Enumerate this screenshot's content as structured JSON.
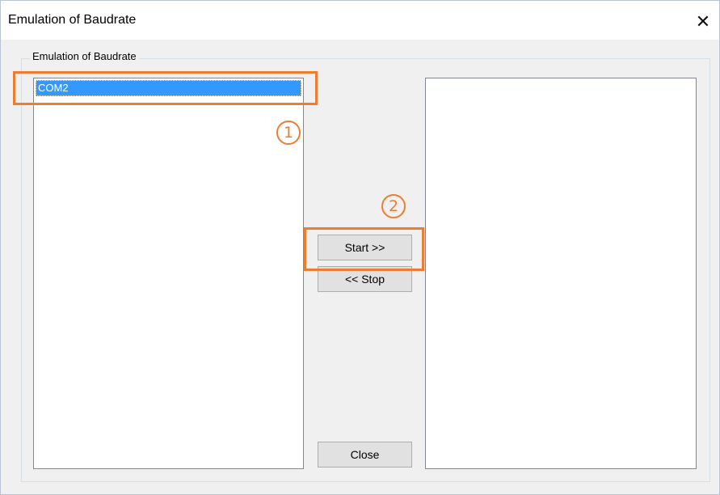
{
  "window": {
    "title": "Emulation of Baudrate",
    "close_glyph": "✕"
  },
  "group": {
    "legend": "Emulation of Baudrate"
  },
  "left_list": {
    "items": [
      {
        "label": "COM2",
        "selected": true
      }
    ]
  },
  "right_list": {
    "items": []
  },
  "buttons": {
    "start_label": "Start >>",
    "stop_label": "<< Stop",
    "close_label": "Close"
  },
  "annotations": {
    "marker_1": "1",
    "marker_2": "2",
    "color": "#ed7d31"
  },
  "colors": {
    "selection": "#3399ff",
    "window_bg": "#f0f0f0"
  }
}
